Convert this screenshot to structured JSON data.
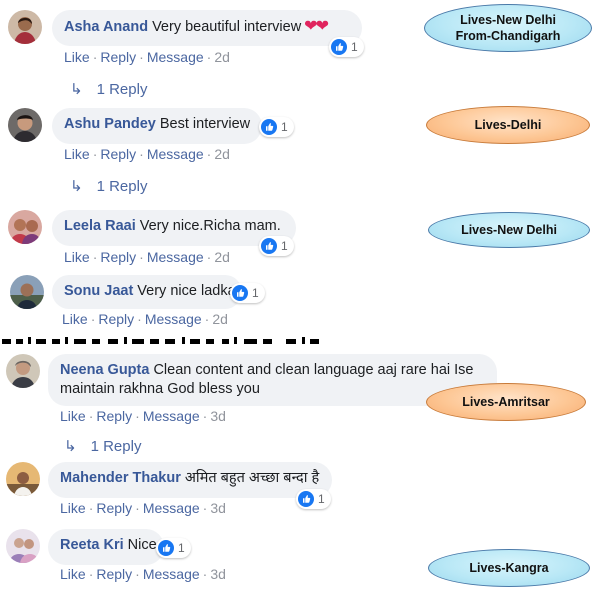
{
  "comments": [
    {
      "author": "Asha Anand",
      "text": "Very beautiful interview",
      "emoji": "❤❤",
      "reaction_count": "1",
      "like": "Like",
      "reply": "Reply",
      "message": "Message",
      "time": "2d",
      "replies": "1 Reply"
    },
    {
      "author": "Ashu Pandey",
      "text": "Best interview",
      "reaction_count": "1",
      "like": "Like",
      "reply": "Reply",
      "message": "Message",
      "time": "2d",
      "replies": "1 Reply"
    },
    {
      "author": "Leela Raai",
      "text": "Very nice.Richa mam.",
      "reaction_count": "1",
      "like": "Like",
      "reply": "Reply",
      "message": "Message",
      "time": "2d"
    },
    {
      "author": "Sonu Jaat",
      "text": "Very nice ladka",
      "reaction_count": "1",
      "like": "Like",
      "reply": "Reply",
      "message": "Message",
      "time": "2d"
    },
    {
      "author": "Neena Gupta",
      "text": "Clean content and clean language aaj rare hai Ise maintain rakhna God bless you",
      "like": "Like",
      "reply": "Reply",
      "message": "Message",
      "time": "3d",
      "replies": "1 Reply"
    },
    {
      "author": "Mahender Thakur",
      "text": "अमित बहुत अच्छा बन्दा है",
      "reaction_count": "1",
      "like": "Like",
      "reply": "Reply",
      "message": "Message",
      "time": "3d"
    },
    {
      "author": "Reeta Kri",
      "text": "Nice",
      "reaction_count": "1",
      "like": "Like",
      "reply": "Reply",
      "message": "Message",
      "time": "3d"
    }
  ],
  "annotations": [
    {
      "text": "Lives-New Delhi From-Chandigarh",
      "color": "blue"
    },
    {
      "text": "Lives-Delhi",
      "color": "orange"
    },
    {
      "text": "Lives-New Delhi",
      "color": "blue"
    },
    {
      "text": "Lives-Amritsar",
      "color": "orange"
    },
    {
      "text": "Lives-Kangra",
      "color": "blue"
    }
  ],
  "colors": {
    "link": "#4b67a1",
    "author": "#385898",
    "bubble": "#f0f2f5",
    "like_blue": "#1877f2",
    "heart": "#e0245e"
  },
  "icons": {
    "reaction": "like-thumb-icon",
    "reply_arrow": "reply-arrow-icon"
  }
}
